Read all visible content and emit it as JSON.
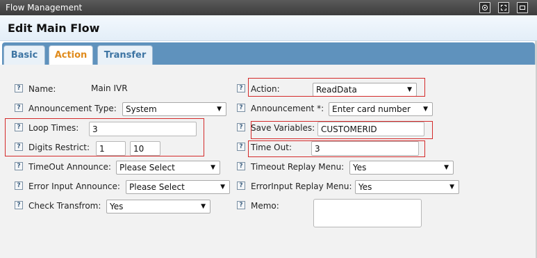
{
  "window": {
    "title": "Flow Management",
    "controls": [
      "target-icon",
      "maximize-icon",
      "minimize-icon"
    ]
  },
  "page": {
    "title": "Edit Main Flow"
  },
  "tabs": [
    {
      "label": "Basic",
      "active": false
    },
    {
      "label": "Action",
      "active": true
    },
    {
      "label": "Transfer",
      "active": false
    }
  ],
  "form": {
    "help_glyph": "?",
    "name": {
      "label": "Name:",
      "value": "Main IVR"
    },
    "announcement_type": {
      "label": "Announcement Type:",
      "value": "System"
    },
    "loop_times": {
      "label": "Loop Times:",
      "value": "3"
    },
    "digits_restrict": {
      "label": "Digits Restrict:",
      "min": "1",
      "max": "10"
    },
    "timeout_announce": {
      "label": "TimeOut Announce:",
      "value": "Please Select"
    },
    "error_input_announce": {
      "label": "Error Input Announce:",
      "value": "Please Select"
    },
    "check_transfrom": {
      "label": "Check Transfrom:",
      "value": "Yes"
    },
    "action": {
      "label": "Action:",
      "value": "ReadData"
    },
    "announcement": {
      "label": "Announcement *:",
      "value": "Enter card number"
    },
    "save_variables": {
      "label": "Save Variables:",
      "value": "CUSTOMERID"
    },
    "time_out": {
      "label": "Time Out:",
      "value": "3"
    },
    "timeout_replay_menu": {
      "label": "Timeout Replay Menu:",
      "value": "Yes"
    },
    "errorinput_replay_menu": {
      "label": "ErrorInput Replay Menu:",
      "value": "Yes"
    },
    "memo": {
      "label": "Memo:",
      "value": ""
    }
  },
  "colors": {
    "titlebar": "#3c3c3c",
    "tabbar": "#5f92bd",
    "active_tab_text": "#e08b1c",
    "highlight": "#d42a2a"
  }
}
